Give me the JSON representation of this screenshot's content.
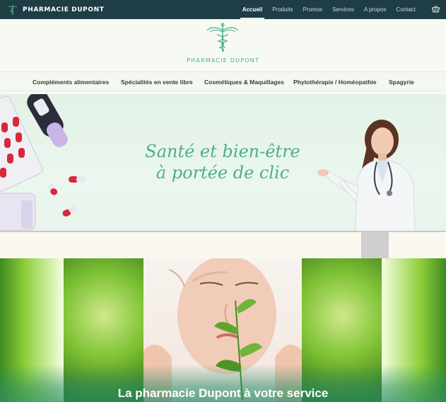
{
  "brand": {
    "name": "PHARMACIE DUPONT"
  },
  "topnav": {
    "items": [
      {
        "label": "Accueil",
        "active": true
      },
      {
        "label": "Produits",
        "active": false
      },
      {
        "label": "Promos",
        "active": false
      },
      {
        "label": "Services",
        "active": false
      },
      {
        "label": "A propos",
        "active": false
      },
      {
        "label": "Contact",
        "active": false
      }
    ],
    "cart_icon": "basket-icon"
  },
  "logo": {
    "text": "PHARMACIE DUPONT",
    "icon": "caduceus-icon",
    "color": "#4cae88"
  },
  "categories": [
    {
      "label": "Compléments alimentaires"
    },
    {
      "label": "Spécialités en vente libre"
    },
    {
      "label": "Cosmétiques & Maquillages"
    },
    {
      "label": "Phytothérapie / Homéopathie"
    },
    {
      "label": "Spagyrie"
    }
  ],
  "hero": {
    "line1": "Santé et bien-être",
    "line2": "à portée de clic"
  },
  "banner": {
    "title": "La pharmacie Dupont à votre service"
  },
  "colors": {
    "topbar": "#1e3d45",
    "accent": "#4fae86"
  }
}
